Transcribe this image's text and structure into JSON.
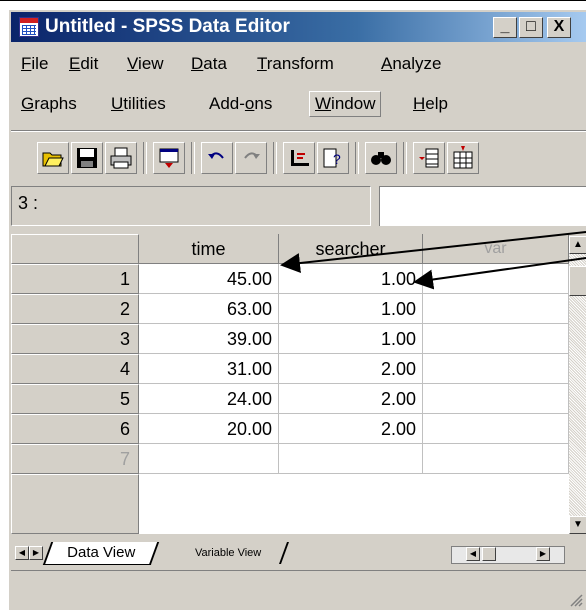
{
  "window": {
    "title": "Untitled - SPSS Data Editor"
  },
  "title_buttons": [
    "_",
    "□",
    "X"
  ],
  "menu_row1": [
    {
      "pre": "",
      "ul": "F",
      "post": "ile"
    },
    {
      "pre": "",
      "ul": "E",
      "post": "dit"
    },
    {
      "pre": "",
      "ul": "V",
      "post": "iew"
    },
    {
      "pre": "",
      "ul": "D",
      "post": "ata"
    },
    {
      "pre": "",
      "ul": "T",
      "post": "ransform"
    },
    {
      "pre": "",
      "ul": "A",
      "post": "nalyze"
    }
  ],
  "menu_row2": [
    {
      "pre": "",
      "ul": "G",
      "post": "raphs"
    },
    {
      "pre": "",
      "ul": "U",
      "post": "tilities"
    },
    {
      "pre": "Add-",
      "ul": "o",
      "post": "ns"
    },
    {
      "pre": "",
      "ul": "W",
      "post": "indow"
    },
    {
      "pre": "",
      "ul": "H",
      "post": "elp"
    }
  ],
  "toolbar_icons": [
    "open-icon",
    "save-icon",
    "print-icon",
    "dialog-recall-icon",
    "undo-icon",
    "redo-icon",
    "goto-case-icon",
    "variables-icon",
    "find-icon",
    "insert-case-icon",
    "insert-variable-icon"
  ],
  "cell_reference": "3 :",
  "columns": [
    "time",
    "searcher",
    "var"
  ],
  "rows": [
    {
      "num": "1",
      "time": "45.00",
      "searcher": "1.00"
    },
    {
      "num": "2",
      "time": "63.00",
      "searcher": "1.00"
    },
    {
      "num": "3",
      "time": "39.00",
      "searcher": "1.00"
    },
    {
      "num": "4",
      "time": "31.00",
      "searcher": "2.00"
    },
    {
      "num": "5",
      "time": "24.00",
      "searcher": "2.00"
    },
    {
      "num": "6",
      "time": "20.00",
      "searcher": "2.00"
    },
    {
      "num": "7",
      "time": "",
      "searcher": ""
    }
  ],
  "tabs": {
    "data_view": "Data View",
    "variable_view": "Variable View"
  }
}
